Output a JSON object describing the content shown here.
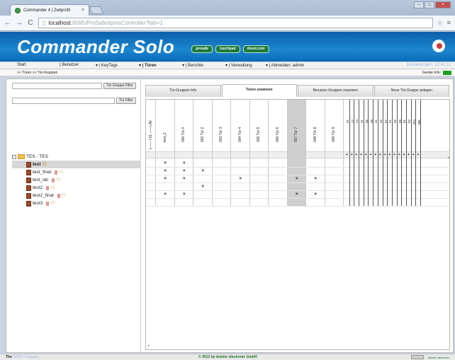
{
  "browser": {
    "tab_title": "Commander 4 | Zeitprofil",
    "tab_close": "×",
    "url_host": "localhost",
    "url_rest": ":6095/ProSafe/tpmsController?tab=1"
  },
  "app": {
    "title": "Commander Solo",
    "badges": [
      "prosafe",
      "touchpad",
      "doxst.com"
    ]
  },
  "menu": {
    "items": [
      "Start",
      "| Benutzer",
      "▾ | KeyTags",
      "▾ | Türen",
      "▾ | Berichte",
      "▾ | Verwaltung",
      "▾ | Abmelden: admin"
    ],
    "right": "Einstellungen: 12:42:11"
  },
  "crumbs": {
    "text": ">> Türen   >> Tür-Gruppen",
    "device_info": "Geräte Info:"
  },
  "filters": {
    "group_filter_label": "Tür-Gruppe Filter",
    "door_filter_label": "Tür Filter"
  },
  "tree": {
    "root": "TES - TES",
    "children": [
      "test",
      "test_final",
      "test_idc",
      "test2",
      "test2_final",
      "test3"
    ]
  },
  "tabs": [
    "Tür-Gruppen Info",
    "Türen zuweisen",
    "Benutzer-Gruppen zuweisen",
    "Neue Tür-Gruppe anlegen"
  ],
  "grid": {
    "first_header": "|—— I 01 ——| AV",
    "columns": [
      "test_2",
      "000 Tür 0",
      "002 Tür 2",
      "003 Tür 3",
      "004 Tür 4",
      "005 Tür 5",
      "006 Tür 6",
      "007 Tür 7",
      "008 Tür 8",
      "009 Tür 9"
    ],
    "slots": [
      "01",
      "17",
      "24",
      "31",
      "35",
      "39",
      "41",
      "45",
      "47",
      "51",
      "55",
      "59",
      "61",
      "62",
      "RO",
      "WE"
    ],
    "plus": "+",
    "mark": "×",
    "marks": [
      {
        "row": 1,
        "cols": [
          1,
          2
        ]
      },
      {
        "row": 2,
        "cols": [
          1,
          2,
          3
        ]
      },
      {
        "row": 3,
        "cols": [
          1,
          2,
          5,
          8,
          9
        ]
      },
      {
        "row": 4,
        "cols": [
          3
        ]
      },
      {
        "row": 5,
        "cols": [
          1,
          2,
          8,
          9
        ]
      }
    ]
  },
  "footer": {
    "brand": "The",
    "brand_sub": "SPDS Company",
    "copyright": "© 2012 by deister electronic GmbH",
    "right_logo": "deister electronic"
  },
  "colors": {
    "header": "#1c86d1",
    "badge": "#1c7a3c",
    "device_led": "#1aa31a"
  }
}
